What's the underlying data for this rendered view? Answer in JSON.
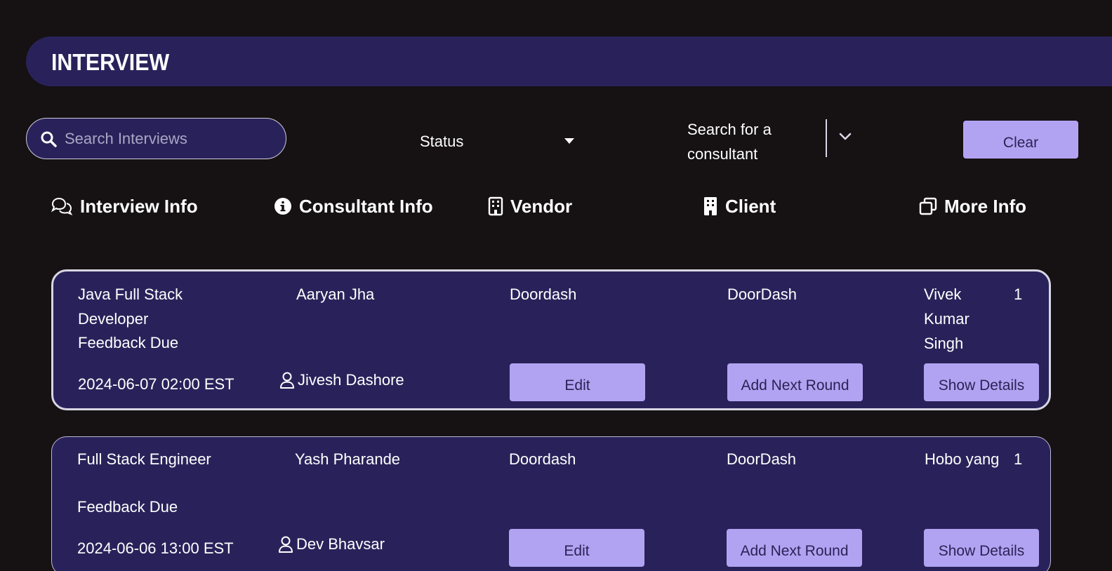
{
  "page": {
    "title": "INTERVIEW"
  },
  "filters": {
    "search_placeholder": "Search Interviews",
    "status_label": "Status",
    "consultant_placeholder": "Search for a consultant",
    "clear_label": "Clear"
  },
  "columns": {
    "interview_info": "Interview Info",
    "consultant_info": "Consultant Info",
    "vendor": "Vendor",
    "client": "Client",
    "more_info": "More Info"
  },
  "interviews": [
    {
      "position": "Java Full Stack Developer",
      "status": "Feedback Due",
      "datetime": "2024-06-07 02:00 EST",
      "consultant": "Aaryan Jha",
      "recruiter": "Jivesh Dashore",
      "vendor": "Doordash",
      "client": "DoorDash",
      "interviewer": "Vivek Kumar Singh",
      "round": "1",
      "edit_label": "Edit",
      "next_round_label": "Add Next Round",
      "details_label": "Show Details"
    },
    {
      "position": "Full Stack Engineer",
      "status": "Feedback Due",
      "datetime": "2024-06-06 13:00 EST",
      "consultant": "Yash Pharande",
      "recruiter": "Dev Bhavsar",
      "vendor": "Doordash",
      "client": "DoorDash",
      "interviewer": "Hobo yang",
      "round": "1",
      "edit_label": "Edit",
      "next_round_label": "Add Next Round",
      "details_label": "Show Details"
    }
  ],
  "colors": {
    "background": "#161112",
    "panel": "#29225a",
    "button": "#b2a3f2",
    "button_text": "#2a2356"
  }
}
